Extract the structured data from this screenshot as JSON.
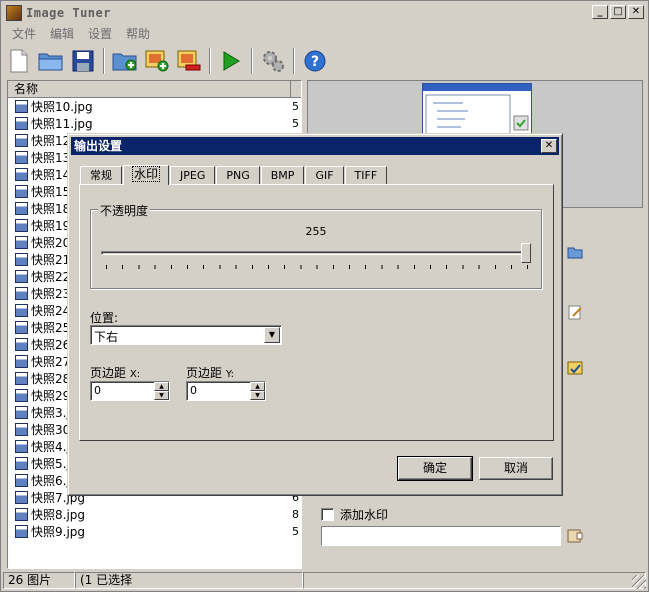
{
  "window": {
    "title": "Image Tuner"
  },
  "menu": [
    "文件",
    "编辑",
    "设置",
    "帮助"
  ],
  "toolbar": {
    "icons": [
      "new-file-icon",
      "open-folder-icon",
      "save-icon",
      "add-folder-icon",
      "add-images-icon",
      "remove-image-icon",
      "play-icon",
      "settings-gears-icon",
      "help-icon"
    ]
  },
  "filelist": {
    "header": "名称",
    "rows": [
      {
        "name": "快照10.jpg",
        "size": "5"
      },
      {
        "name": "快照11.jpg",
        "size": "5"
      },
      {
        "name": "快照12",
        "size": ""
      },
      {
        "name": "快照13",
        "size": ""
      },
      {
        "name": "快照14",
        "size": ""
      },
      {
        "name": "快照15",
        "size": ""
      },
      {
        "name": "快照18",
        "size": ""
      },
      {
        "name": "快照19",
        "size": ""
      },
      {
        "name": "快照20",
        "size": ""
      },
      {
        "name": "快照21",
        "size": ""
      },
      {
        "name": "快照22",
        "size": ""
      },
      {
        "name": "快照23",
        "size": ""
      },
      {
        "name": "快照24",
        "size": ""
      },
      {
        "name": "快照25",
        "size": ""
      },
      {
        "name": "快照26",
        "size": ""
      },
      {
        "name": "快照27",
        "size": ""
      },
      {
        "name": "快照28",
        "size": ""
      },
      {
        "name": "快照29",
        "size": ""
      },
      {
        "name": "快照3.j",
        "size": ""
      },
      {
        "name": "快照30",
        "size": ""
      },
      {
        "name": "快照4.j",
        "size": ""
      },
      {
        "name": "快照5.j",
        "size": ""
      },
      {
        "name": "快照6.j",
        "size": ""
      },
      {
        "name": "快照7.jpg",
        "size": "6"
      },
      {
        "name": "快照8.jpg",
        "size": "8"
      },
      {
        "name": "快照9.jpg",
        "size": "5"
      }
    ]
  },
  "watermark": {
    "checkbox_label": "添加水印",
    "text_value": ""
  },
  "status": {
    "count": "26 图片",
    "selected": "(1 已选择"
  },
  "dialog": {
    "title": "输出设置",
    "tabs": [
      "常规",
      "水印",
      "JPEG",
      "PNG",
      "BMP",
      "GIF",
      "TIFF"
    ],
    "active_tab": "水印",
    "opacity": {
      "label": "不透明度",
      "value": "255",
      "fraction": 1.0
    },
    "position": {
      "label": "位置:",
      "value": "下右"
    },
    "margin_x": {
      "label": "页边距",
      "axis": "X:",
      "value": "0"
    },
    "margin_y": {
      "label": "页边距",
      "axis": "Y:",
      "value": "0"
    },
    "ok_label": "确定",
    "cancel_label": "取消"
  }
}
